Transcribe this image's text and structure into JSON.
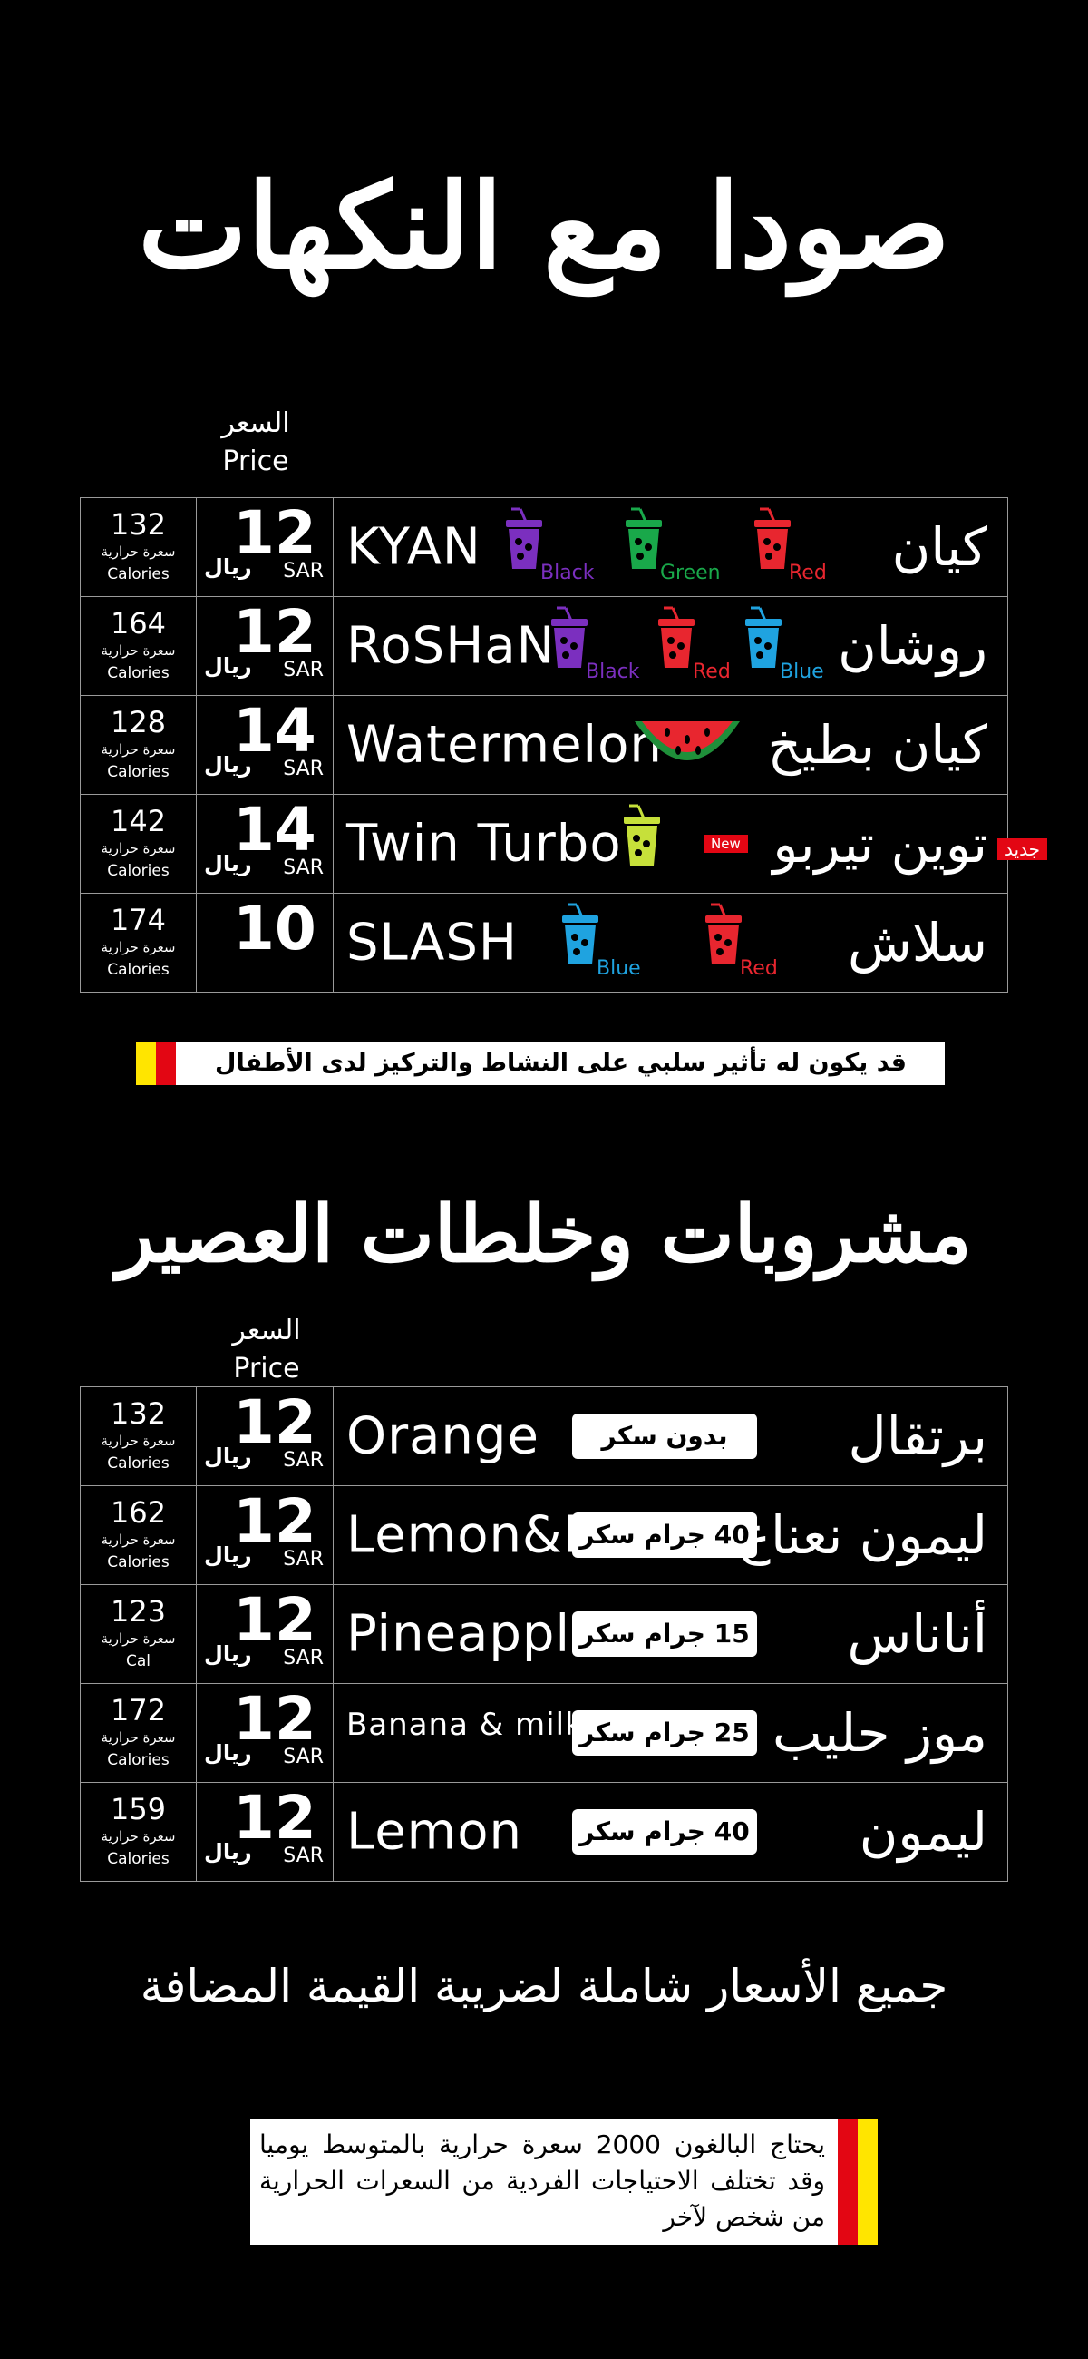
{
  "soda_section": {
    "title": "صودا مع النكهات",
    "price_header_ar": "السعر",
    "price_header_en": "Price",
    "rows": [
      {
        "calories": "132",
        "cal_ar": "سعرة حرارية",
        "cal_en": "Calories",
        "price": "12",
        "currency_ar": "ريال",
        "currency_en": "SAR",
        "name_en": "KYAN",
        "name_ar": "كيان",
        "cups": [
          {
            "color": "#7b2fbf",
            "label": "Black"
          },
          {
            "color": "#19a84a",
            "label": "Green"
          },
          {
            "color": "#e8262f",
            "label": "Red"
          }
        ]
      },
      {
        "calories": "164",
        "cal_ar": "سعرة حرارية",
        "cal_en": "Calories",
        "price": "12",
        "currency_ar": "ريال",
        "currency_en": "SAR",
        "name_en": "RoSHaN",
        "name_ar": "روشان",
        "cups": [
          {
            "color": "#7b2fbf",
            "label": "Black"
          },
          {
            "color": "#e8262f",
            "label": "Red"
          },
          {
            "color": "#1fa3e0",
            "label": "Blue"
          }
        ]
      },
      {
        "calories": "128",
        "cal_ar": "سعرة حرارية",
        "cal_en": "Calories",
        "price": "14",
        "currency_ar": "ريال",
        "currency_en": "SAR",
        "name_en": "Watermelon",
        "name_ar": "كيان بطيخ",
        "icon": "watermelon-icon"
      },
      {
        "calories": "142",
        "cal_ar": "سعرة حرارية",
        "cal_en": "Calories",
        "price": "14",
        "currency_ar": "ريال",
        "currency_en": "SAR",
        "name_en": "Twin Turbo",
        "name_ar": "توين تيربو",
        "cups": [
          {
            "color": "#c6e03a",
            "label": ""
          }
        ],
        "new_en": "New",
        "new_ar": "جديد"
      },
      {
        "calories": "174",
        "cal_ar": "سعرة حرارية",
        "cal_en": "Calories",
        "price": "10",
        "currency_ar": "",
        "currency_en": "",
        "name_en": "SLASH",
        "name_ar": "سلاش",
        "cups": [
          {
            "color": "#1fa3e0",
            "label": "Blue"
          },
          {
            "color": "#e8262f",
            "label": "Red"
          }
        ]
      }
    ],
    "warning": "قد يكون له تأثير سلبي على النشاط والتركيز لدى الأطفال"
  },
  "juice_section": {
    "title": "مشروبات وخلطات العصير",
    "price_header_ar": "السعر",
    "price_header_en": "Price",
    "rows": [
      {
        "calories": "132",
        "cal_ar": "سعرة حرارية",
        "cal_en": "Calories",
        "price": "12",
        "currency_ar": "ريال",
        "currency_en": "SAR",
        "name_en": "Orange",
        "name_ar": "برتقال",
        "sugar": "بدون سكر"
      },
      {
        "calories": "162",
        "cal_ar": "سعرة حرارية",
        "cal_en": "Calories",
        "price": "12",
        "currency_ar": "ريال",
        "currency_en": "SAR",
        "name_en": "Lemon&Mint",
        "name_ar": "ليمون نعناع",
        "sugar": "40 جرام سكر"
      },
      {
        "calories": "123",
        "cal_ar": "سعرة حرارية",
        "cal_en": "Cal",
        "price": "12",
        "currency_ar": "ريال",
        "currency_en": "SAR",
        "name_en": "Pineapple",
        "name_ar": "أناناس",
        "sugar": "15 جرام سكر"
      },
      {
        "calories": "172",
        "cal_ar": "سعرة حرارية",
        "cal_en": "Calories",
        "price": "12",
        "currency_ar": "ريال",
        "currency_en": "SAR",
        "name_en": "Banana & milk",
        "name_ar": "موز حليب",
        "sugar": "25 جرام سكر"
      },
      {
        "calories": "159",
        "cal_ar": "سعرة حرارية",
        "cal_en": "Calories",
        "price": "12",
        "currency_ar": "ريال",
        "currency_en": "SAR",
        "name_en": "Lemon",
        "name_ar": "ليمون",
        "sugar": "40 جرام سكر"
      }
    ]
  },
  "vat_note": "جميع الأسعار شاملة لضريبة القيمة المضافة",
  "calorie_note": "يحتاج البالغون 2000 سعرة حرارية بالمتوسط يوميا وقد تختلف الاحتياجات الفردية من السعرات الحرارية من شخص لآخر",
  "colors": {
    "background": "#000000",
    "text": "#ffffff",
    "accent_red": "#e30613",
    "accent_yellow": "#ffe500"
  }
}
